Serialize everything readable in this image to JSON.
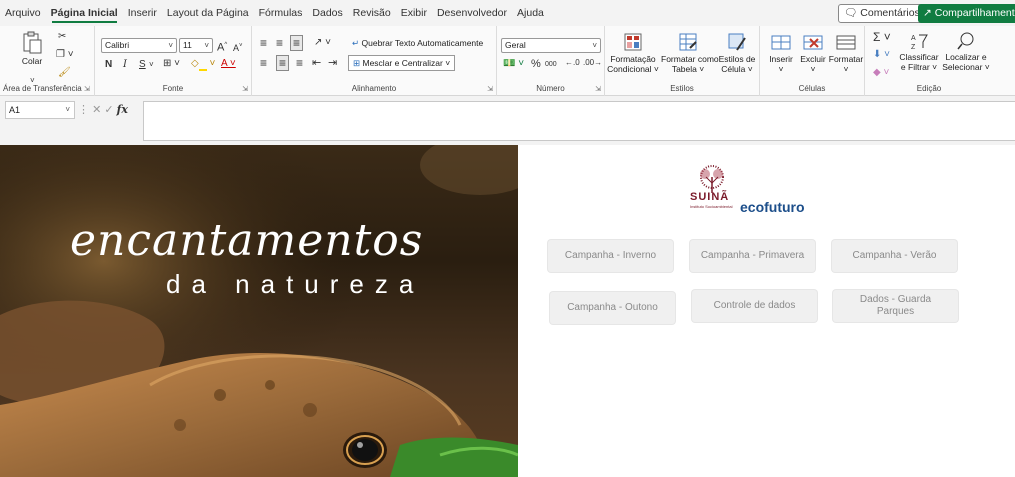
{
  "menu": {
    "tabs": [
      "Arquivo",
      "Página Inicial",
      "Inserir",
      "Layout da Página",
      "Fórmulas",
      "Dados",
      "Revisão",
      "Exibir",
      "Desenvolvedor",
      "Ajuda"
    ],
    "comments_label": "Comentários",
    "share_label": "Compartilhamento"
  },
  "ribbon": {
    "clipboard": {
      "paste_label": "Colar",
      "group_label": "Área de Transferência"
    },
    "font": {
      "font_name": "Calibri",
      "font_size": "11",
      "bold": "N",
      "italic": "I",
      "underline": "S",
      "grow": "A",
      "shrink": "A",
      "group_label": "Fonte"
    },
    "alignment": {
      "wrap_text": "Quebrar Texto Automaticamente",
      "merge_center": "Mesclar e Centralizar",
      "group_label": "Alinhamento"
    },
    "number": {
      "format": "Geral",
      "percent": "%",
      "thousands": "000",
      "group_label": "Número"
    },
    "styles": {
      "conditional": [
        "Formatação",
        "Condicional ˅"
      ],
      "as_table": [
        "Formatar como",
        "Tabela ˅"
      ],
      "cell_styles": [
        "Estilos de",
        "Célula ˅"
      ],
      "group_label": "Estilos"
    },
    "cells": {
      "insert": "Inserir",
      "delete": "Excluir",
      "format": "Formatar",
      "group_label": "Células"
    },
    "editing": {
      "sort_filter": [
        "Classificar",
        "e Filtrar ˅"
      ],
      "find_select": [
        "Localizar e",
        "Selecionar ˅"
      ],
      "group_label": "Edição"
    }
  },
  "formula_bar": {
    "cell_ref": "A1",
    "fx": "fx",
    "value": ""
  },
  "banner": {
    "title_script": "encantamentos",
    "title_sub": "da natureza"
  },
  "logos": {
    "suina": "SUINÃ",
    "suina_sub": "Instituto Socioambiental",
    "ecofuturo": "ecofuturo"
  },
  "buttons": [
    "Campanha - Inverno",
    "Campanha - Primavera",
    "Campanha - Verão",
    "Campanha - Outono",
    "Controle de dados",
    "Dados - Guarda Parques"
  ],
  "colors": {
    "excel_green": "#107c41",
    "suina_red": "#7a1a2a",
    "ecofuturo_blue": "#1c4e8a"
  }
}
